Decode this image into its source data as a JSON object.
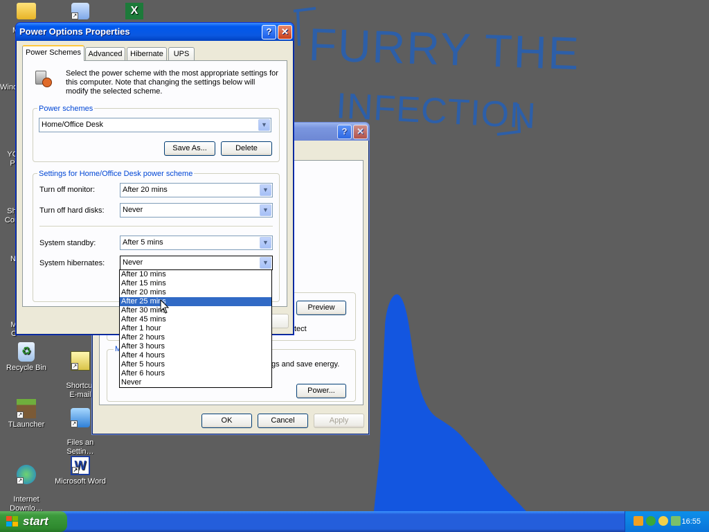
{
  "wallpaper": {
    "title_line1": "FURRY THE",
    "title_line2": "INFECTION"
  },
  "desktop_icons": [
    {
      "label": "M"
    },
    {
      "label": ""
    },
    {
      "label": ""
    },
    {
      "label": "Wind"
    },
    {
      "label": "YC\nP"
    },
    {
      "label": "Sh\nCon"
    },
    {
      "label": "N"
    },
    {
      "label": "M\nC"
    },
    {
      "label": "Recycle Bin"
    },
    {
      "label": "Shortcut\nE-mail"
    },
    {
      "label": "TLauncher"
    },
    {
      "label": "Files an\nSettin…"
    },
    {
      "label": "Internet\nDownlo…"
    },
    {
      "label": "Microsoft Word"
    }
  ],
  "power_dialog": {
    "title": "Power Options Properties",
    "help_glyph": "?",
    "close_glyph": "✕",
    "tabs": [
      "Power Schemes",
      "Advanced",
      "Hibernate",
      "UPS"
    ],
    "active_tab": "Power Schemes",
    "description": "Select the power scheme with the most appropriate settings for this computer. Note that changing the settings below will modify the selected scheme.",
    "schemes_group": {
      "label": "Power schemes",
      "selected": "Home/Office Desk",
      "save_as": "Save As...",
      "delete": "Delete"
    },
    "settings_group": {
      "label": "Settings for Home/Office Desk power scheme",
      "monitor_label": "Turn off monitor:",
      "monitor_value": "After 20 mins",
      "disks_label": "Turn off hard disks:",
      "disks_value": "Never",
      "standby_label": "System standby:",
      "standby_value": "After 5 mins",
      "hibernate_label": "System hibernates:",
      "hibernate_value": "Never"
    },
    "hibernate_options": [
      "After 10 mins",
      "After 15 mins",
      "After 20 mins",
      "After 25 mins",
      "After 30 mins",
      "After 45 mins",
      "After 1 hour",
      "After 2 hours",
      "After 3 hours",
      "After 4 hours",
      "After 5 hours",
      "After 6 hours",
      "Never"
    ],
    "highlighted_option": "After 25 mins",
    "arrow_glyph": "▼"
  },
  "display_dialog": {
    "help_glyph": "?",
    "close_glyph": "✕",
    "preview": "Preview",
    "partial_text_1": "tect",
    "group_fragment": "M",
    "partial_text_2": "gs and save energy.",
    "power_button": "Power...",
    "ok": "OK",
    "cancel": "Cancel",
    "apply": "Apply"
  },
  "taskbar": {
    "start_label": "start",
    "clock": "16:55"
  },
  "colors": {
    "desktop": "#5e5e5e",
    "wallpaper_blue": "#1356e0",
    "xp_blue": "#0058ee",
    "selection": "#316ac5"
  }
}
